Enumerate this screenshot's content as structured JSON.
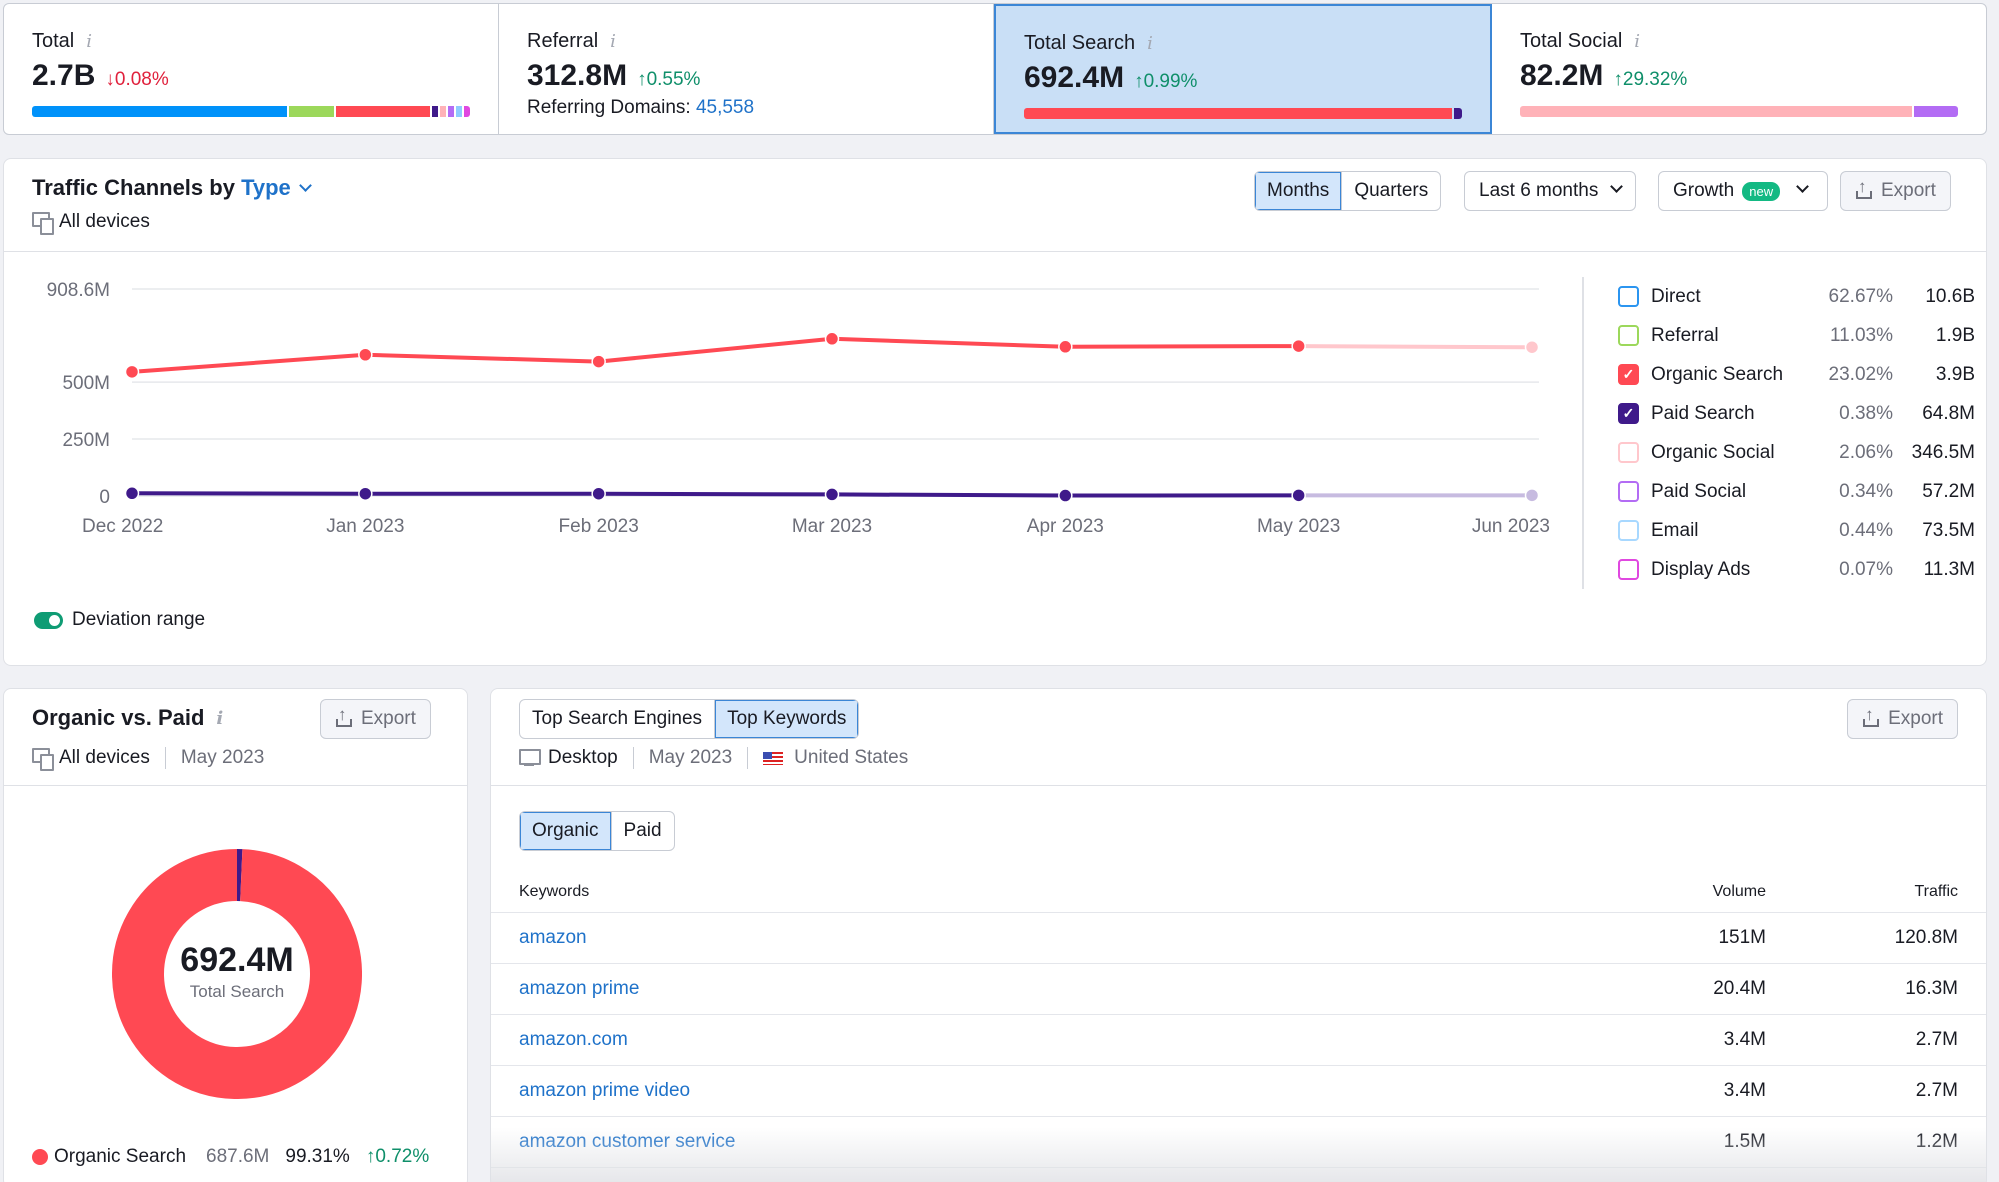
{
  "summary": [
    {
      "label": "Total",
      "value": "2.7B",
      "delta": "0.08%",
      "direction": "down",
      "bar": [
        {
          "name": "Direct",
          "pct": 62.67,
          "color": "#0092fa"
        },
        {
          "name": "Referral",
          "pct": 11.03,
          "color": "#9cd85b"
        },
        {
          "name": "Organic Search",
          "pct": 23.02,
          "color": "#ff4953"
        },
        {
          "name": "Paid Search",
          "pct": 1.5,
          "color": "#3f1a8a"
        },
        {
          "name": "Organic Social",
          "pct": 1.5,
          "color": "#ffb2b8"
        },
        {
          "name": "Paid Social",
          "pct": 1.5,
          "color": "#b36cf4"
        },
        {
          "name": "Email",
          "pct": 1.5,
          "color": "#8fccff"
        },
        {
          "name": "Display Ads",
          "pct": 1.5,
          "color": "#e048e0"
        }
      ]
    },
    {
      "label": "Referral",
      "value": "312.8M",
      "delta": "0.55%",
      "direction": "up",
      "sub_label": "Referring Domains:",
      "sub_value": "45,558"
    },
    {
      "label": "Total Search",
      "value": "692.4M",
      "delta": "0.99%",
      "direction": "up",
      "active": true,
      "bar": [
        {
          "name": "Organic Search",
          "pct": 98.2,
          "color": "#ff4953"
        },
        {
          "name": "Paid Search",
          "pct": 1.8,
          "color": "#3f1a8a"
        }
      ]
    },
    {
      "label": "Total Social",
      "value": "82.2M",
      "delta": "29.32%",
      "direction": "up",
      "bar": [
        {
          "name": "Organic Social",
          "pct": 90,
          "color": "#ffb2b8"
        },
        {
          "name": "Paid Social",
          "pct": 10,
          "color": "#b36cf4"
        }
      ]
    }
  ],
  "traffic": {
    "title_prefix": "Traffic Channels by",
    "title_type": "Type",
    "devices": "All devices",
    "period_tabs": [
      {
        "label": "Months",
        "active": true
      },
      {
        "label": "Quarters",
        "active": false
      }
    ],
    "range_select": "Last 6 months",
    "growth_select": "Growth",
    "growth_badge": "new",
    "export_label": "Export",
    "toggle_label": "Deviation range",
    "toggle_on": true,
    "legend": [
      {
        "name": "Direct",
        "pct": "62.67%",
        "value": "10.6B",
        "color": "#2b95f0",
        "checked": false
      },
      {
        "name": "Referral",
        "pct": "11.03%",
        "value": "1.9B",
        "color": "#9cd85b",
        "checked": false
      },
      {
        "name": "Organic Search",
        "pct": "23.02%",
        "value": "3.9B",
        "color": "#ff4953",
        "checked": true
      },
      {
        "name": "Paid Search",
        "pct": "0.38%",
        "value": "64.8M",
        "color": "#3f1a8a",
        "checked": true
      },
      {
        "name": "Organic Social",
        "pct": "2.06%",
        "value": "346.5M",
        "color": "#ffc7cc",
        "checked": false
      },
      {
        "name": "Paid Social",
        "pct": "0.34%",
        "value": "57.2M",
        "color": "#b36cf4",
        "checked": false
      },
      {
        "name": "Email",
        "pct": "0.44%",
        "value": "73.5M",
        "color": "#a8d8ff",
        "checked": false
      },
      {
        "name": "Display Ads",
        "pct": "0.07%",
        "value": "11.3M",
        "color": "#e048e0",
        "checked": false
      }
    ]
  },
  "chart_data": {
    "type": "line",
    "title": "Traffic Channels by Type",
    "x": [
      "Dec 2022",
      "Jan 2023",
      "Feb 2023",
      "Mar 2023",
      "Apr 2023",
      "May 2023",
      "Jun 2023"
    ],
    "y_ticks": [
      {
        "value": 0,
        "label": "0"
      },
      {
        "value": 250,
        "label": "250M"
      },
      {
        "value": 500,
        "label": "500M"
      },
      {
        "value": 908.6,
        "label": "908.6M"
      }
    ],
    "ylim": [
      0,
      908.6
    ],
    "yunit": "M",
    "grid": true,
    "projected_from_index": 5,
    "series": [
      {
        "name": "Organic Search",
        "color": "#ff4953",
        "projected_color": "#ffc7cc",
        "values": [
          545,
          620,
          590,
          690,
          655,
          658,
          653
        ]
      },
      {
        "name": "Paid Search",
        "color": "#3f1a8a",
        "projected_color": "#c7bbe0",
        "values": [
          12,
          10,
          10,
          7,
          2,
          3,
          3
        ]
      }
    ]
  },
  "organic_vs_paid": {
    "title": "Organic vs. Paid",
    "export_label": "Export",
    "devices": "All devices",
    "date": "May 2023",
    "center_value": "692.4M",
    "center_label": "Total Search",
    "slices": [
      {
        "name": "Organic Search",
        "pct": 99.31,
        "color": "#ff4953"
      },
      {
        "name": "Paid Search",
        "pct": 0.69,
        "color": "#3f1a8a"
      }
    ],
    "legend": {
      "name": "Organic Search",
      "value": "687.6M",
      "pct": "99.31%",
      "delta": "0.72%"
    }
  },
  "keywords": {
    "tabs": [
      {
        "label": "Top Search Engines",
        "active": false
      },
      {
        "label": "Top Keywords",
        "active": true
      }
    ],
    "export_label": "Export",
    "device": "Desktop",
    "date": "May 2023",
    "country": "United States",
    "mode_tabs": [
      {
        "label": "Organic",
        "active": true
      },
      {
        "label": "Paid",
        "active": false
      }
    ],
    "columns": {
      "keyword": "Keywords",
      "volume": "Volume",
      "traffic": "Traffic"
    },
    "rows": [
      {
        "keyword": "amazon",
        "volume": "151M",
        "traffic": "120.8M"
      },
      {
        "keyword": "amazon prime",
        "volume": "20.4M",
        "traffic": "16.3M"
      },
      {
        "keyword": "amazon.com",
        "volume": "3.4M",
        "traffic": "2.7M"
      },
      {
        "keyword": "amazon prime video",
        "volume": "3.4M",
        "traffic": "2.7M"
      },
      {
        "keyword": "amazon customer service",
        "volume": "1.5M",
        "traffic": "1.2M"
      }
    ]
  }
}
